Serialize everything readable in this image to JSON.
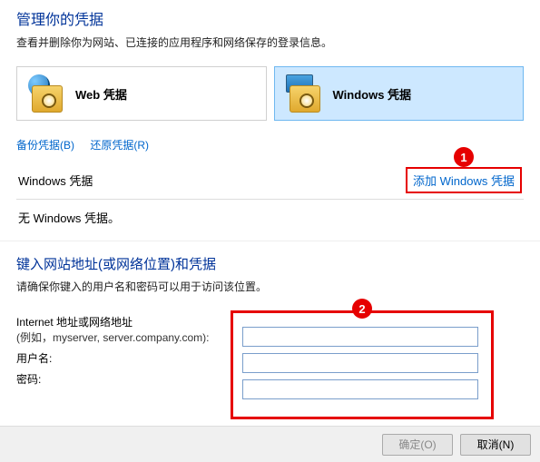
{
  "top": {
    "title": "管理你的凭据",
    "desc": "查看并删除你为网站、已连接的应用程序和网络保存的登录信息。",
    "tile_web": "Web 凭据",
    "tile_windows": "Windows 凭据",
    "backup": "备份凭据(B)",
    "restore": "还原凭据(R)",
    "section_label": "Windows 凭据",
    "add_link": "添加 Windows 凭据",
    "none": "无 Windows 凭据。"
  },
  "form": {
    "title": "键入网站地址(或网络位置)和凭据",
    "desc": "请确保你键入的用户名和密码可以用于访问该位置。",
    "addr_label": "Internet 地址或网络地址",
    "addr_hint": "(例如，myserver, server.company.com):",
    "user_label": "用户名:",
    "pass_label": "密码:"
  },
  "markers": {
    "m1": "1",
    "m2": "2"
  },
  "buttons": {
    "ok": "确定(O)",
    "cancel": "取消(N)"
  }
}
